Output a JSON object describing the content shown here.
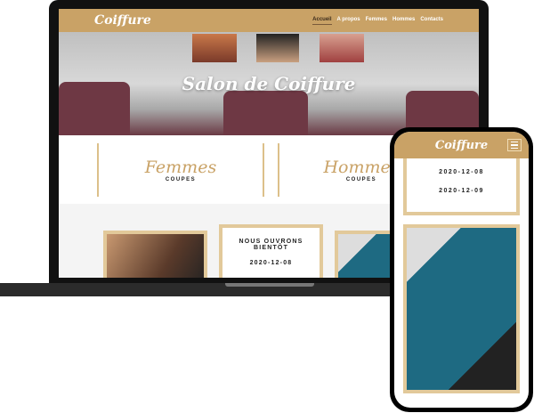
{
  "desktop": {
    "logo": "Coiffure",
    "nav": [
      "Accueil",
      "A propos",
      "Femmes",
      "Hommes",
      "Contacts"
    ],
    "hero_title": "Salon de Coiffure",
    "categories": [
      {
        "title": "Femmes",
        "subtitle": "COUPES"
      },
      {
        "title": "Hommes",
        "subtitle": "COUPES"
      }
    ],
    "card": {
      "heading": "NOUS OUVRONS BIENTÔT",
      "date": "2020-12-08"
    }
  },
  "mobile": {
    "logo": "Coiffure",
    "dates": [
      "2020-12-08",
      "2020-12-09"
    ]
  }
}
